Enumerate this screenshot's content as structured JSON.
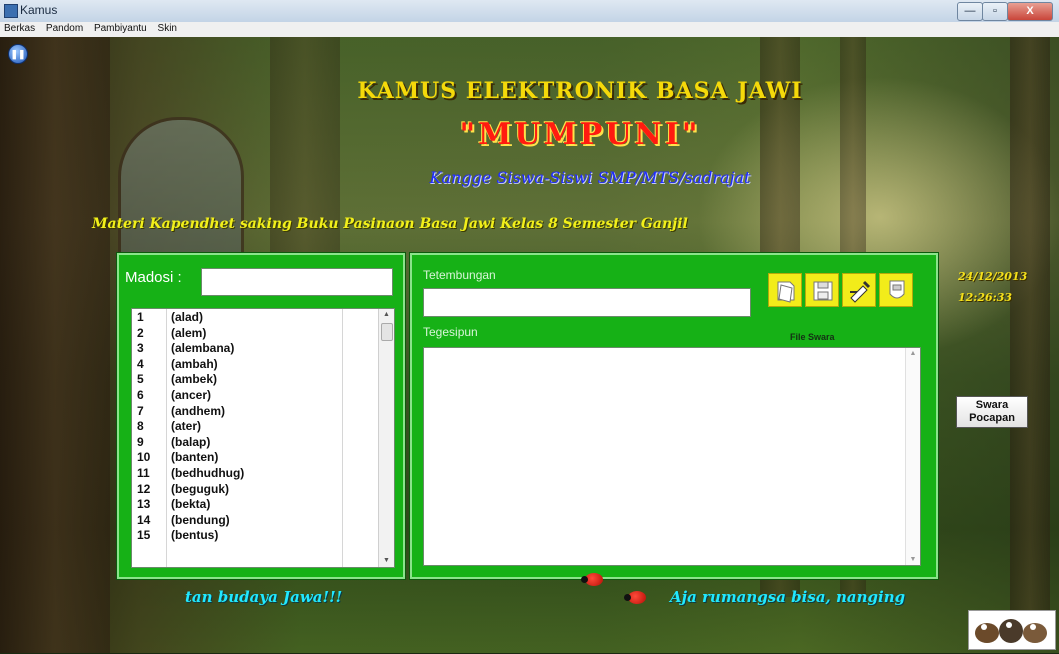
{
  "window": {
    "title": "Kamus",
    "min_label": "—",
    "max_label": "▫",
    "close_label": "X"
  },
  "menu": [
    "Berkas",
    "Pandom",
    "Pambiyantu",
    "Skin"
  ],
  "header": {
    "title": "KAMUS ELEKTRONIK BASA JAWI",
    "name": "\"MUMPUNI\"",
    "subtitle": "Kangge Siswa-Siswi SMP/MTS/sadrajat",
    "materi": "Materi Kapendhet saking Buku Pasinaon Basa Jawi Kelas 8 Semester Ganjil"
  },
  "search": {
    "label": "Madosi :",
    "value": ""
  },
  "word_list": [
    {
      "num": "1",
      "word": "(alad)"
    },
    {
      "num": "2",
      "word": "(alem)"
    },
    {
      "num": "3",
      "word": "(alembana)"
    },
    {
      "num": "4",
      "word": "(ambah)"
    },
    {
      "num": "5",
      "word": "(ambek)"
    },
    {
      "num": "6",
      "word": "(ancer)"
    },
    {
      "num": "7",
      "word": "(andhem)"
    },
    {
      "num": "8",
      "word": "(ater)"
    },
    {
      "num": "9",
      "word": "(balap)"
    },
    {
      "num": "10",
      "word": "(banten)"
    },
    {
      "num": "11",
      "word": "(bedhudhug)"
    },
    {
      "num": "12",
      "word": "(beguguk)"
    },
    {
      "num": "13",
      "word": "(bekta)"
    },
    {
      "num": "14",
      "word": "(bendung)"
    },
    {
      "num": "15",
      "word": "(bentus)"
    }
  ],
  "detail": {
    "tetembungan_label": "Tetembungan",
    "tetembungan_value": "",
    "tegesipun_label": "Tegesipun",
    "file_label": "File Swara"
  },
  "file_buttons": [
    "open-file-icon",
    "save-disk-icon",
    "edit-pen-icon",
    "close-doc-icon"
  ],
  "datetime": {
    "date": "24/12/2013",
    "time": "12:26:33"
  },
  "swara_button": {
    "line1": "Swara",
    "line2": "Pocapan"
  },
  "footer": {
    "left": "tan budaya Jawa!!!",
    "right": "Aja rumangsa bisa, nanging"
  },
  "colors": {
    "panel_green": "#16b116",
    "title_yellow": "#f5d90a",
    "name_red": "#ff1b10",
    "subtitle_blue": "#1f2cff",
    "footer_cyan": "#21e8ff"
  }
}
